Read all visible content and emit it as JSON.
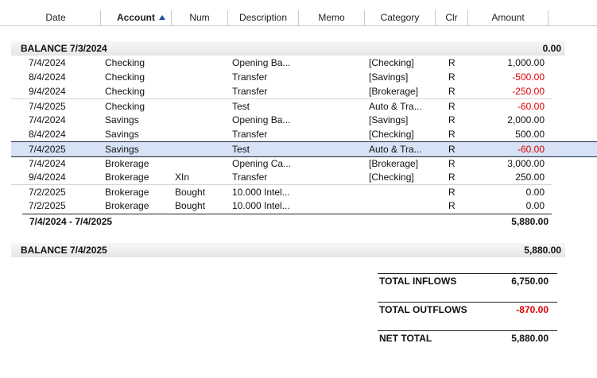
{
  "columns": [
    "Date",
    "Account",
    "Num",
    "Description",
    "Memo",
    "Category",
    "Clr",
    "Amount"
  ],
  "sort_indicator": "sort-ascending-icon",
  "balance_start": {
    "label": "BALANCE 7/3/2024",
    "amount": "0.00"
  },
  "rows": [
    {
      "date": "7/4/2024",
      "account": "Checking",
      "num": "",
      "description": "Opening Ba...",
      "memo": "",
      "category": "[Checking]",
      "clr": "R",
      "amount": "1,000.00",
      "negative": false
    },
    {
      "date": "8/4/2024",
      "account": "Checking",
      "num": "",
      "description": "Transfer",
      "memo": "",
      "category": "[Savings]",
      "clr": "R",
      "amount": "-500.00",
      "negative": true
    },
    {
      "date": "9/4/2024",
      "account": "Checking",
      "num": "",
      "description": "Transfer",
      "memo": "",
      "category": "[Brokerage]",
      "clr": "R",
      "amount": "-250.00",
      "negative": true
    },
    {
      "date": "7/4/2025",
      "account": "Checking",
      "num": "",
      "description": "Test",
      "memo": "",
      "category": "Auto & Tra...",
      "clr": "R",
      "amount": "-60.00",
      "negative": true
    },
    {
      "date": "7/4/2024",
      "account": "Savings",
      "num": "",
      "description": "Opening Ba...",
      "memo": "",
      "category": "[Savings]",
      "clr": "R",
      "amount": "2,000.00",
      "negative": false
    },
    {
      "date": "8/4/2024",
      "account": "Savings",
      "num": "",
      "description": "Transfer",
      "memo": "",
      "category": "[Checking]",
      "clr": "R",
      "amount": "500.00",
      "negative": false
    },
    {
      "date": "7/4/2025",
      "account": "Savings",
      "num": "",
      "description": "Test",
      "memo": "",
      "category": "Auto & Tra...",
      "clr": "R",
      "amount": "-60.00",
      "negative": true,
      "selected": true
    },
    {
      "date": "7/4/2024",
      "account": "Brokerage",
      "num": "",
      "description": "Opening Ca...",
      "memo": "",
      "category": "[Brokerage]",
      "clr": "R",
      "amount": "3,000.00",
      "negative": false
    },
    {
      "date": "9/4/2024",
      "account": "Brokerage",
      "num": "XIn",
      "description": "Transfer",
      "memo": "",
      "category": "[Checking]",
      "clr": "R",
      "amount": "250.00",
      "negative": false
    },
    {
      "date": "7/2/2025",
      "account": "Brokerage",
      "num": "Bought",
      "description": "10.000 Intel...",
      "memo": "",
      "category": "",
      "clr": "R",
      "amount": "0.00",
      "negative": false
    },
    {
      "date": "7/2/2025",
      "account": "Brokerage",
      "num": "Bought",
      "description": "10.000 Intel...",
      "memo": "",
      "category": "",
      "clr": "R",
      "amount": "0.00",
      "negative": false
    }
  ],
  "subtotal": {
    "label": "7/4/2024 - 7/4/2025",
    "amount": "5,880.00"
  },
  "balance_end": {
    "label": "BALANCE 7/4/2025",
    "amount": "5,880.00"
  },
  "totals": {
    "inflows": {
      "label": "TOTAL INFLOWS",
      "amount": "6,750.00"
    },
    "outflows": {
      "label": "TOTAL OUTFLOWS",
      "amount": "-870.00"
    },
    "net": {
      "label": "NET TOTAL",
      "amount": "5,880.00"
    }
  },
  "colors": {
    "negative": "#e00000",
    "selection": "#d6e2f5",
    "sort_arrow": "#1c4fa0"
  }
}
